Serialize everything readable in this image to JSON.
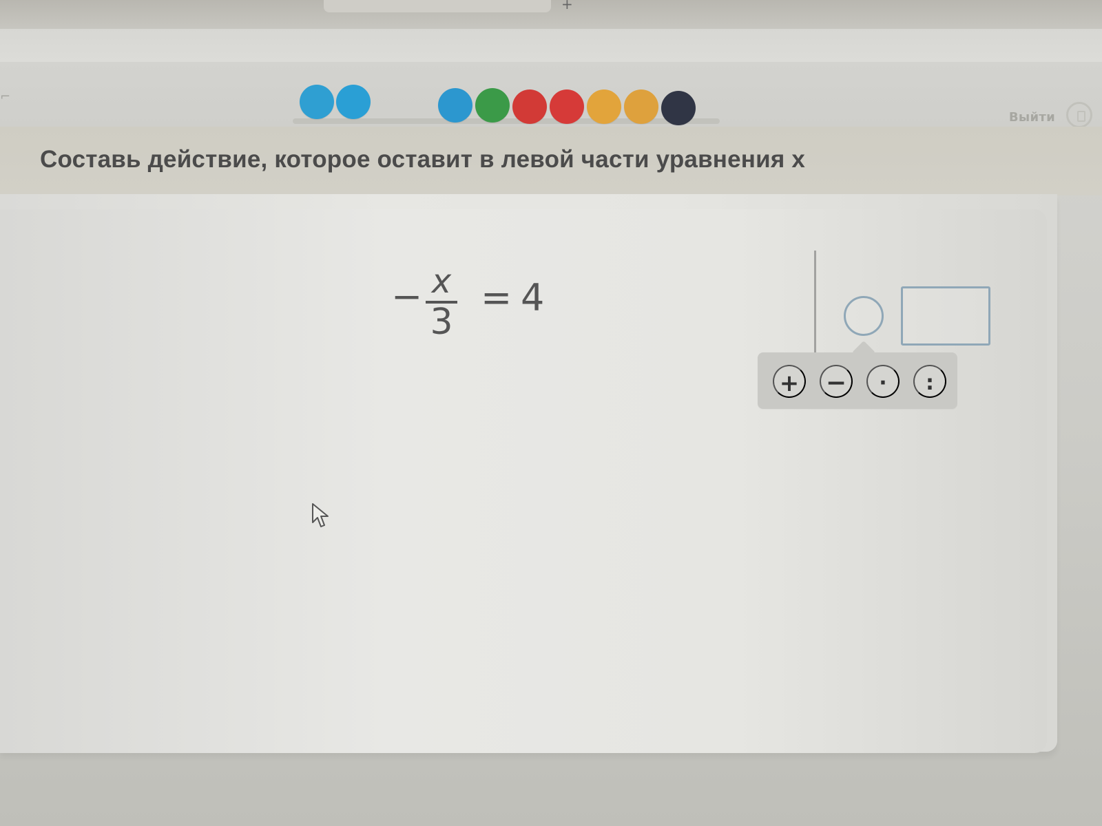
{
  "task": {
    "title": "Составь действие, которое оставит в левой части уравнения x"
  },
  "header": {
    "logout_label": "Выйти",
    "logout_icon": "logout-icon",
    "progress_dot_colors": [
      "#2f9fd2",
      "#2a9fd5",
      "#2c97cf",
      "#3b9a48",
      "#d23a36",
      "#d63a38",
      "#e2a43b",
      "#dea13d",
      "#303545"
    ]
  },
  "equation": {
    "minus": "−",
    "numerator": "x",
    "denominator": "3",
    "equals": "=",
    "rhs": "4"
  },
  "constructor": {
    "operator_buttons": [
      "+",
      "−",
      "·",
      ":"
    ]
  },
  "colors": {
    "slot_border": "#8fa7b7",
    "popover_background": "#c9c9c5"
  }
}
